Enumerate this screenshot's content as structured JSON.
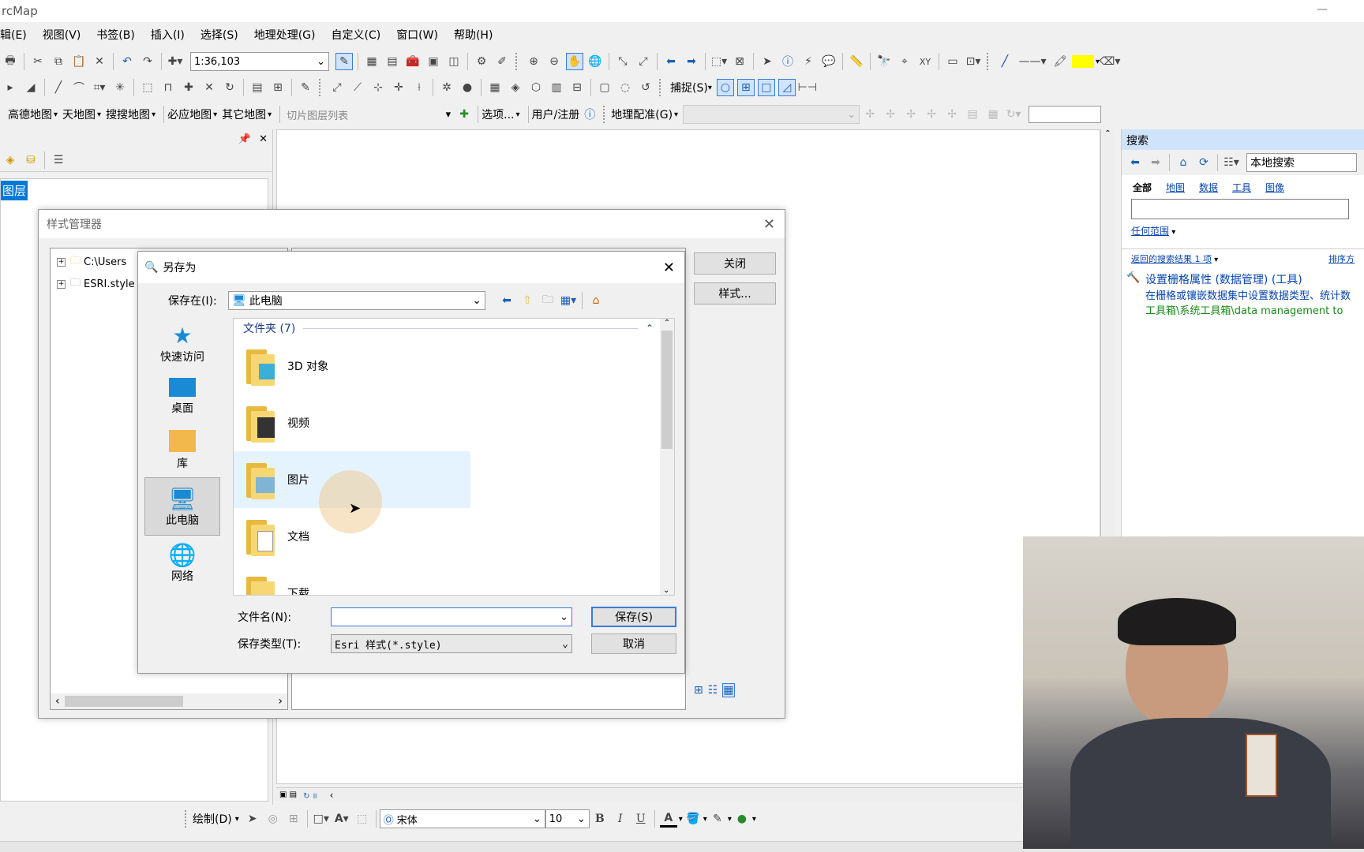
{
  "app": {
    "title": "rcMap",
    "window_controls": [
      "—",
      "□"
    ]
  },
  "menu": [
    "辑(E)",
    "视图(V)",
    "书签(B)",
    "插入(I)",
    "选择(S)",
    "地理处理(G)",
    "自定义(C)",
    "窗口(W)",
    "帮助(H)"
  ],
  "toolbar1": {
    "scale": "1:36,103"
  },
  "toolbar2": {
    "snapping": "捕捉(S)"
  },
  "toolbar3": {
    "basemaps": [
      "高德地图",
      "天地图",
      "搜搜地图",
      "必应地图",
      "其它地图"
    ],
    "tile_layer_placeholder": "切片图层列表",
    "options": "选项...",
    "user_reg": "用户/注册",
    "georef": "地理配准(G)"
  },
  "toc": {
    "layer_label": "图层"
  },
  "search": {
    "title": "搜索",
    "scope": "本地搜索",
    "tabs": [
      "全部",
      "地图",
      "数据",
      "工具",
      "图像"
    ],
    "any_extent": "任何范围",
    "results_count": "返回的搜索结果 1 项",
    "sort": "排序方",
    "result_title": "设置栅格属性 (数据管理) (工具)",
    "result_desc": "在栅格或镶嵌数据集中设置数据类型、统计数",
    "result_path": "工具箱\\系统工具箱\\data management to"
  },
  "style_manager": {
    "title": "样式管理器",
    "tree": [
      "C:\\Users",
      "ESRI.style"
    ],
    "close_btn": "关闭",
    "styles_btn": "样式..."
  },
  "save_dialog": {
    "title": "另存为",
    "save_in_label": "保存在(I):",
    "location": "此电脑",
    "group_header": "文件夹 (7)",
    "nav": [
      "快速访问",
      "桌面",
      "库",
      "此电脑",
      "网络"
    ],
    "folders": [
      "3D 对象",
      "视频",
      "图片",
      "文档",
      "下载"
    ],
    "filename_label": "文件名(N):",
    "filename_value": "",
    "filetype_label": "保存类型(T):",
    "filetype_value": "Esri 样式(*.style)",
    "save_btn": "保存(S)",
    "cancel_btn": "取消"
  },
  "draw_toolbar": {
    "draw": "绘制(D)",
    "font": "宋体",
    "font_size": "10",
    "bold": "B",
    "italic": "I",
    "underline": "U",
    "font_color_icon": "A"
  }
}
